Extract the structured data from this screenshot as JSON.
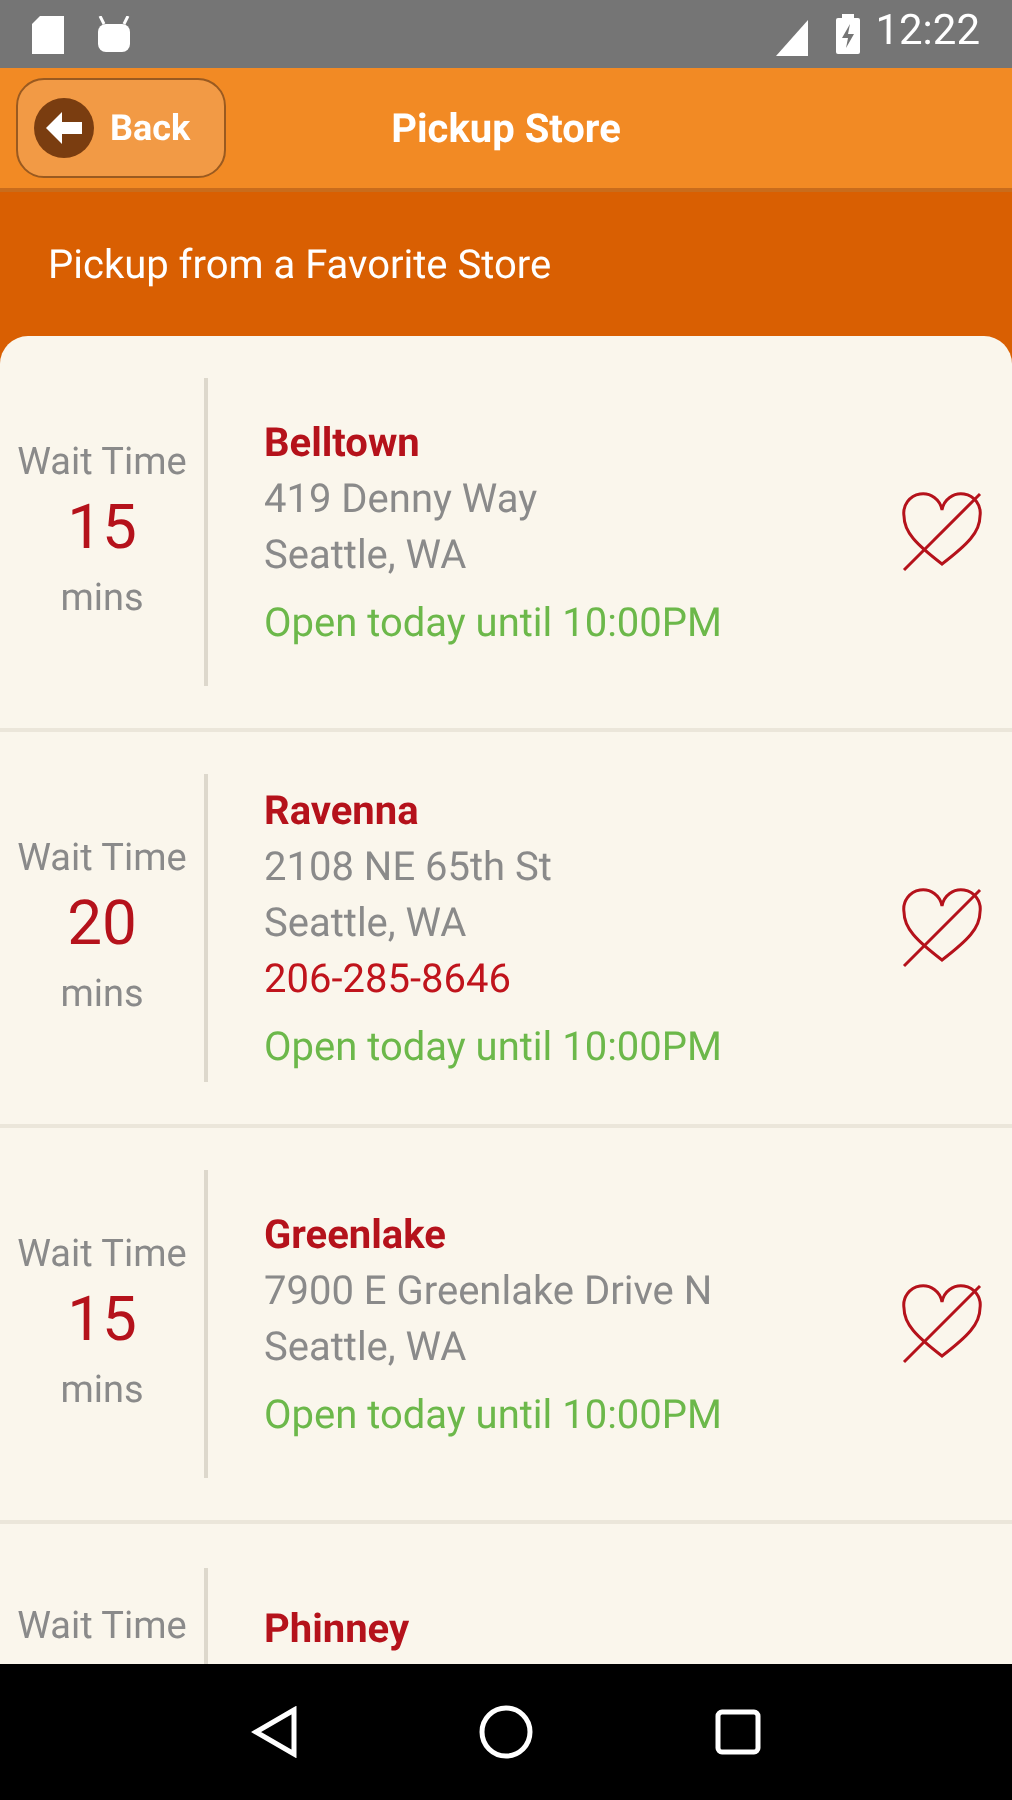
{
  "status_bar": {
    "time": "12:22"
  },
  "header": {
    "back": "Back",
    "title": "Pickup Store"
  },
  "section_title": "Pickup from a Favorite Store",
  "stores": [
    {
      "wait_label": "Wait Time",
      "wait": "15",
      "wait_unit": "mins",
      "name": "Belltown",
      "address": [
        "419 Denny Way",
        "Seattle, WA"
      ],
      "hours": "Open today until 10:00PM"
    },
    {
      "wait_label": "Wait Time",
      "wait": "20",
      "wait_unit": "mins",
      "name": "Ravenna",
      "address": [
        "2108 NE 65th St",
        "Seattle, WA"
      ],
      "phone": "206-285-8646",
      "hours": "Open today until 10:00PM"
    },
    {
      "wait_label": "Wait Time",
      "wait": "15",
      "wait_unit": "mins",
      "name": "Greenlake",
      "address": [
        "7900 E Greenlake Drive N",
        "Seattle, WA"
      ],
      "hours": "Open today until 10:00PM"
    },
    {
      "wait_label": "Wait Time",
      "name": "Phinney"
    }
  ]
}
